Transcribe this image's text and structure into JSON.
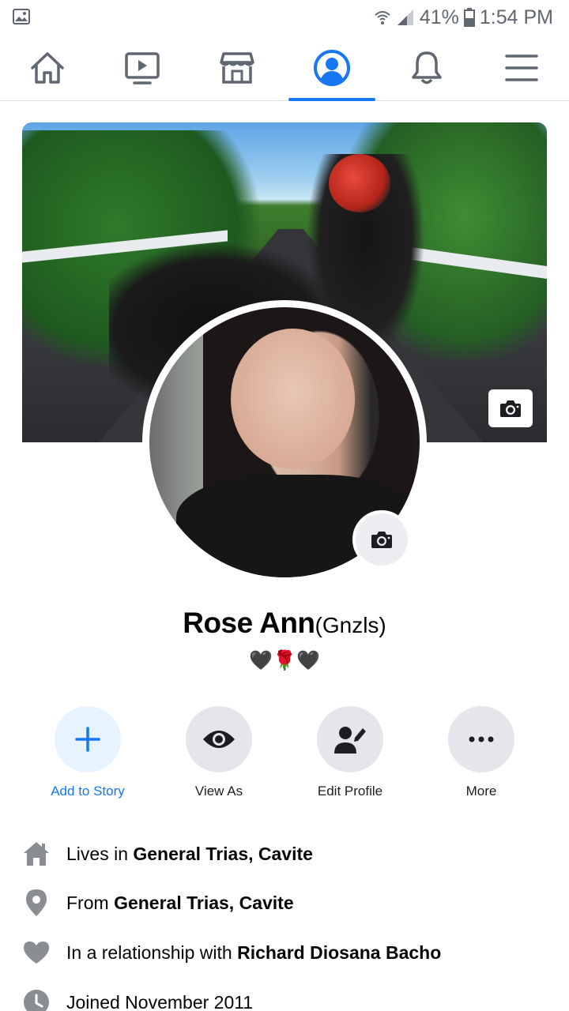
{
  "status_bar": {
    "battery": "41%",
    "time": "1:54 PM",
    "icons": [
      "image-icon",
      "wifi-icon",
      "signal-icon",
      "battery-icon"
    ]
  },
  "nav": {
    "items": [
      {
        "name": "home",
        "icon": "home-icon"
      },
      {
        "name": "watch",
        "icon": "video-icon"
      },
      {
        "name": "marketplace",
        "icon": "store-icon"
      },
      {
        "name": "profile",
        "icon": "profile-icon",
        "active": true
      },
      {
        "name": "notifications",
        "icon": "bell-icon"
      },
      {
        "name": "menu",
        "icon": "hamburger-icon"
      }
    ],
    "accent": "#1877f2"
  },
  "profile": {
    "name": "Rose Ann",
    "alt_name": "(Gnzls)",
    "bio_emojis": [
      "🖤",
      "🌹",
      "🖤"
    ]
  },
  "actions": [
    {
      "label": "Add to Story",
      "icon": "plus-icon",
      "primary": true
    },
    {
      "label": "View As",
      "icon": "eye-icon"
    },
    {
      "label": "Edit Profile",
      "icon": "edit-profile-icon"
    },
    {
      "label": "More",
      "icon": "more-icon"
    }
  ],
  "details": [
    {
      "icon": "home-icon",
      "prefix": "Lives in ",
      "value": "General Trias, Cavite"
    },
    {
      "icon": "location-pin-icon",
      "prefix": "From ",
      "value": "General Trias, Cavite"
    },
    {
      "icon": "heart-icon",
      "prefix": "In a relationship with ",
      "value": "Richard Diosana Bacho"
    },
    {
      "icon": "clock-icon",
      "prefix": "Joined ",
      "value": "November 2011"
    }
  ]
}
